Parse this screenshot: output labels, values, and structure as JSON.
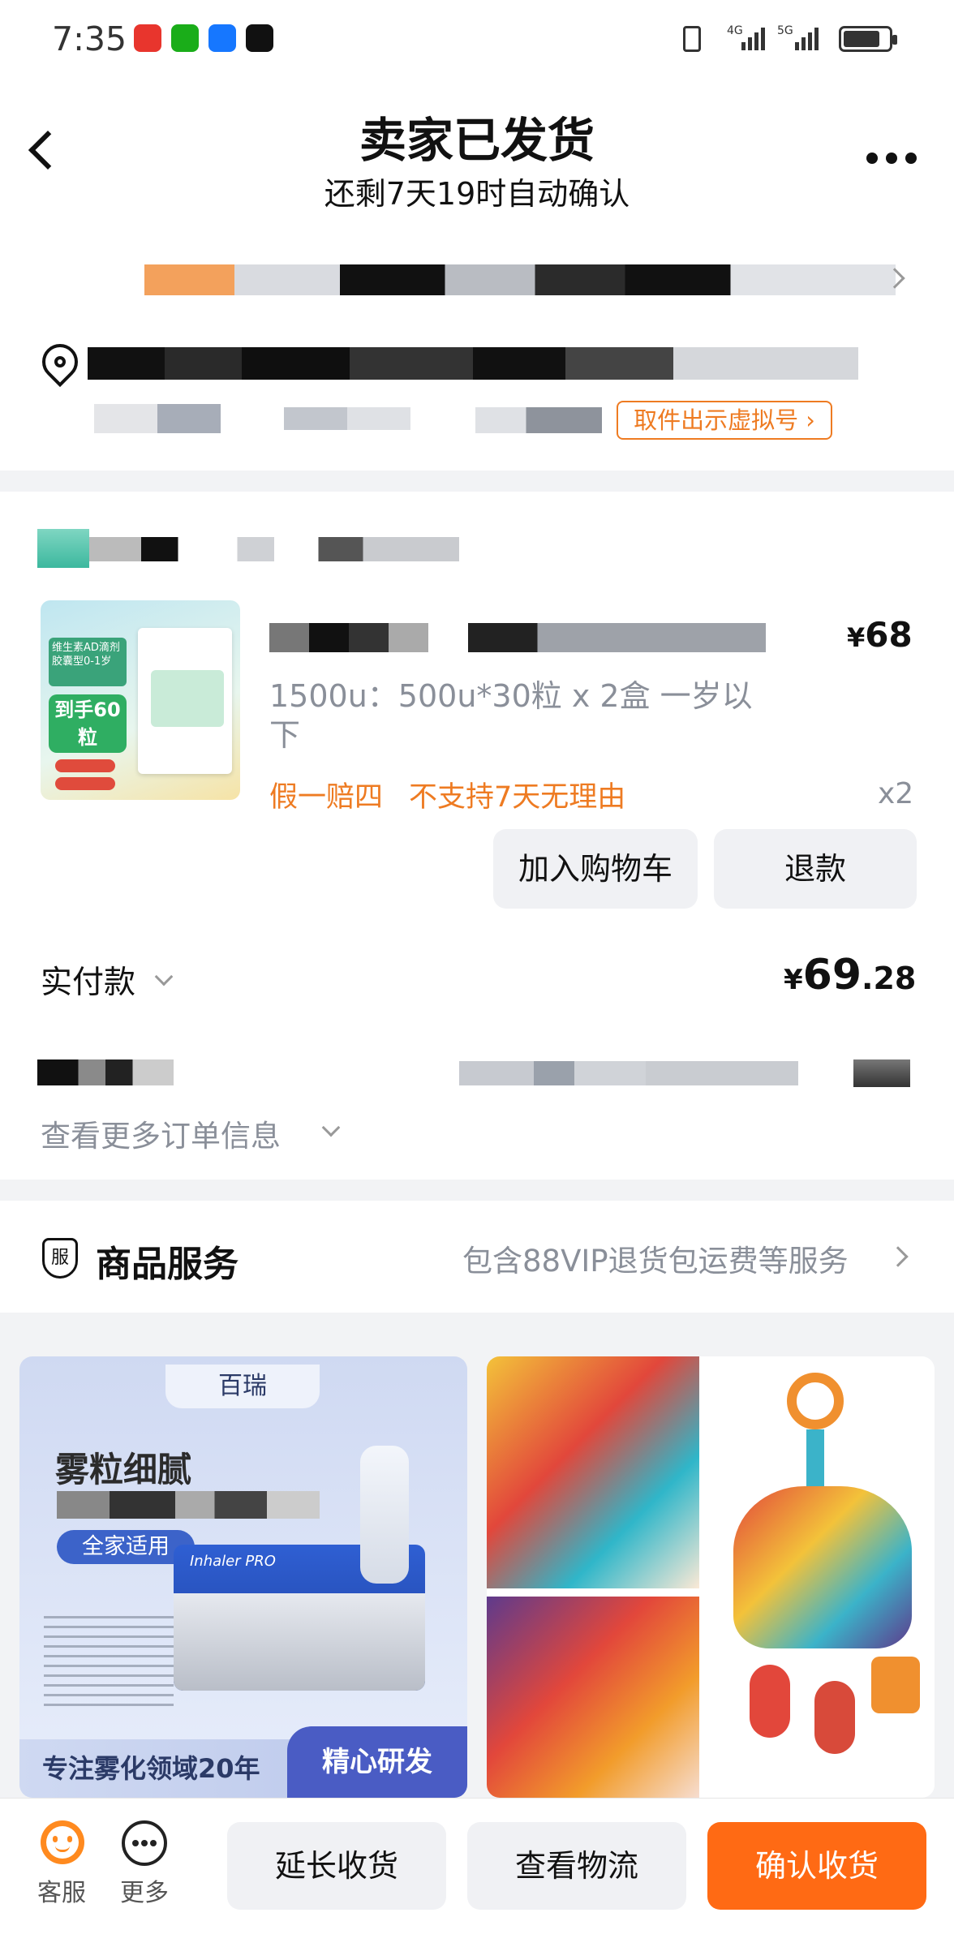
{
  "status_bar": {
    "time": "7:35"
  },
  "header": {
    "title": "卖家已发货",
    "subtitle": "还剩7天19时自动确认"
  },
  "address": {
    "pickup_button": "取件出示虚拟号"
  },
  "product": {
    "spec": "1500u：500u*30粒 x 2盒 一岁以下",
    "tag1": "假一赔四",
    "tag2": "不支持7天无理由",
    "currency": "¥",
    "price": "68",
    "qty": "x2",
    "btn_cart": "加入购物车",
    "btn_refund": "退款",
    "image": {
      "badge": "到手60粒",
      "subtitle": "维生素AD滴剂胶囊型0-1岁"
    }
  },
  "payment": {
    "label": "实付款",
    "currency": "¥",
    "amount_int": "69",
    "amount_dec": ".28"
  },
  "order_more": "查看更多订单信息",
  "service": {
    "icon_char": "服",
    "title": "商品服务",
    "desc": "包含88VIP退货包运费等服务"
  },
  "recommend": {
    "card1": {
      "brand": "百瑞",
      "headline": "雾粒细腻",
      "tag": "全家适用",
      "device": "Inhaler PRO",
      "banner_left": "专注雾化领域20年",
      "banner_right": "精心研发"
    }
  },
  "bottom": {
    "service": "客服",
    "more": "更多",
    "extend": "延长收货",
    "logistics": "查看物流",
    "confirm": "确认收货"
  },
  "colors": {
    "accent": "#ff6a14",
    "orange_text": "#ee7b22",
    "grey_text": "#8a8f99"
  }
}
